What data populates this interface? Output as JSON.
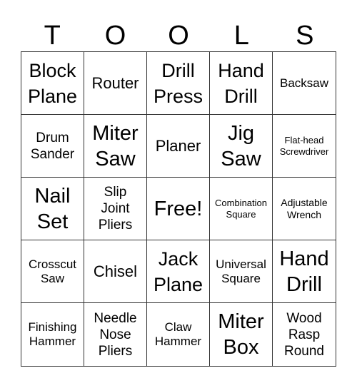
{
  "title_letters": [
    "T",
    "O",
    "O",
    "L",
    "S"
  ],
  "cells": [
    {
      "label": "Block Plane",
      "size": "l"
    },
    {
      "label": "Router",
      "size": "m"
    },
    {
      "label": "Drill Press",
      "size": "l"
    },
    {
      "label": "Hand Drill",
      "size": "l"
    },
    {
      "label": "Backsaw",
      "size": "sm"
    },
    {
      "label": "Drum Sander",
      "size": "n"
    },
    {
      "label": "Miter Saw",
      "size": "xl"
    },
    {
      "label": "Planer",
      "size": "m"
    },
    {
      "label": "Jig Saw",
      "size": "xl"
    },
    {
      "label": "Flat-head Screwdriver",
      "size": "xxs"
    },
    {
      "label": "Nail Set",
      "size": "xl"
    },
    {
      "label": "Slip Joint Pliers",
      "size": "n"
    },
    {
      "label": "Free!",
      "size": "xl"
    },
    {
      "label": "Combination Square",
      "size": "xxs"
    },
    {
      "label": "Adjustable Wrench",
      "size": "xs"
    },
    {
      "label": "Crosscut Saw",
      "size": "sm"
    },
    {
      "label": "Chisel",
      "size": "m"
    },
    {
      "label": "Jack Plane",
      "size": "l"
    },
    {
      "label": "Universal Square",
      "size": "sm"
    },
    {
      "label": "Hand Drill",
      "size": "xl"
    },
    {
      "label": "Finishing Hammer",
      "size": "sm"
    },
    {
      "label": "Needle Nose Pliers",
      "size": "n"
    },
    {
      "label": "Claw Hammer",
      "size": "sm"
    },
    {
      "label": "Miter Box",
      "size": "xl"
    },
    {
      "label": "Wood Rasp Round",
      "size": "n"
    }
  ]
}
